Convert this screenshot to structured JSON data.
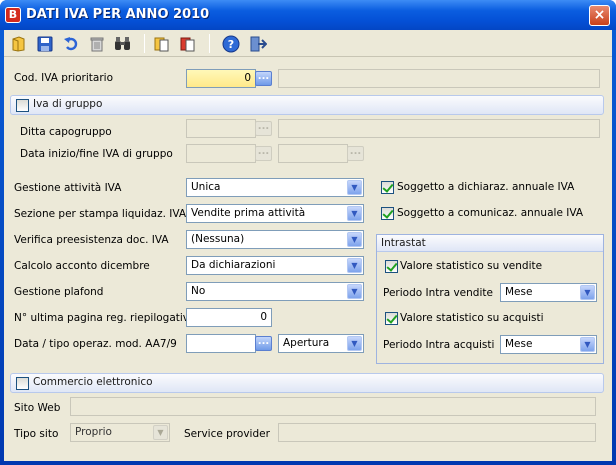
{
  "window": {
    "title": "DATI IVA PER ANNO 2010",
    "app_icon": "B",
    "close": "×"
  },
  "toolbar": {
    "icons": [
      "new-icon",
      "save-icon",
      "undo-icon",
      "delete-icon",
      "search-icon",
      "copy-icon",
      "paste-icon",
      "help-icon",
      "exit-icon"
    ]
  },
  "cod_iva": {
    "label": "Cod. IVA prioritario",
    "value": "0",
    "desc": ""
  },
  "iva_gruppo": {
    "label": "Iva di gruppo",
    "ditta_label": "Ditta capogruppo",
    "data_label": "Data inizio/fine IVA di gruppo"
  },
  "gestione_attivita": {
    "label": "Gestione attività IVA",
    "value": "Unica"
  },
  "sezione": {
    "label": "Sezione per stampa liquidaz. IVA",
    "value": "Vendite prima attività"
  },
  "verifica": {
    "label": "Verifica preesistenza doc. IVA",
    "value": "(Nessuna)"
  },
  "calcolo": {
    "label": "Calcolo acconto dicembre",
    "value": "Da dichiarazioni"
  },
  "plafond": {
    "label": "Gestione plafond",
    "value": "No"
  },
  "ultima_pagina": {
    "label": "N° ultima pagina reg. riepilogativo",
    "value": "0"
  },
  "data_tipo": {
    "label": "Data / tipo operaz. mod. AA7/9",
    "tipo_value": "Apertura"
  },
  "soggetto_dich": {
    "label": "Soggetto a dichiaraz. annuale IVA",
    "checked": true
  },
  "soggetto_com": {
    "label": "Soggetto a comunicaz. annuale IVA",
    "checked": true
  },
  "intrastat": {
    "title": "Intrastat",
    "val_vendite": {
      "label": "Valore statistico su vendite",
      "checked": true
    },
    "periodo_vendite": {
      "label": "Periodo Intra vendite",
      "value": "Mese"
    },
    "val_acquisti": {
      "label": "Valore statistico su acquisti",
      "checked": true
    },
    "periodo_acquisti": {
      "label": "Periodo Intra acquisti",
      "value": "Mese"
    }
  },
  "commercio": {
    "label": "Commercio elettronico",
    "sito_label": "Sito Web",
    "tipo_label": "Tipo sito",
    "tipo_value": "Proprio",
    "provider_label": "Service provider"
  }
}
